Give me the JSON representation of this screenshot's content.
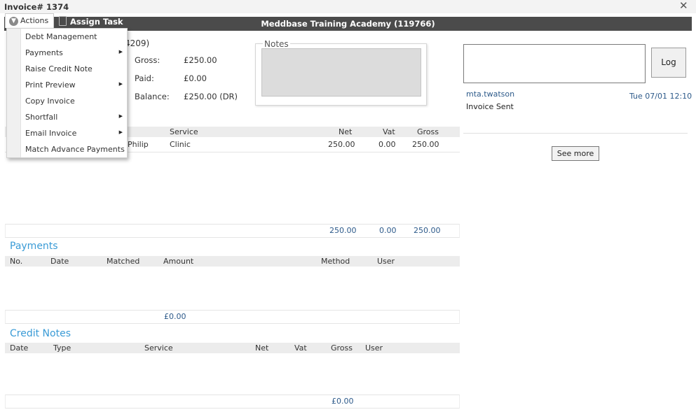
{
  "window": {
    "title": "Invoice# 1374",
    "close_glyph": "✕"
  },
  "header": {
    "title": "Meddbase Training Academy (119766)",
    "actions_label": "Actions",
    "assign_label": "Assign Task"
  },
  "actions_menu": {
    "items": [
      {
        "label": "Debt Management",
        "has_submenu": false
      },
      {
        "label": "Payments",
        "has_submenu": true
      },
      {
        "label": "Raise Credit Note",
        "has_submenu": false
      },
      {
        "label": "Print Preview",
        "has_submenu": true
      },
      {
        "label": "Copy Invoice",
        "has_submenu": false
      },
      {
        "label": "Shortfall",
        "has_submenu": true
      },
      {
        "label": "Email Invoice",
        "has_submenu": true
      },
      {
        "label": "Match Advance Payments",
        "has_submenu": false
      }
    ]
  },
  "invoice": {
    "partial_id": "4209)",
    "gross_label": "Gross:",
    "gross_value": "£250.00",
    "paid_label": "Paid:",
    "paid_value": "£0.00",
    "balance_label": "Balance:",
    "balance_value": "£250.00 (DR)"
  },
  "notes": {
    "legend": "Notes",
    "value": ""
  },
  "log": {
    "input_value": "",
    "button_label": "Log",
    "entries": [
      {
        "user": "mta.twatson",
        "date": "Tue 07/01 12:10",
        "message": "Invoice Sent"
      }
    ],
    "see_more_label": "See more"
  },
  "items_table": {
    "columns": {
      "service": "Service",
      "net": "Net",
      "vat": "Vat",
      "gross": "Gross"
    },
    "rows": [
      {
        "patient_partial": "Philip",
        "service": "Clinic",
        "net": "250.00",
        "vat": "0.00",
        "gross": "250.00"
      }
    ],
    "totals": {
      "net": "250.00",
      "vat": "0.00",
      "gross": "250.00"
    }
  },
  "payments": {
    "title": "Payments",
    "columns": {
      "no": "No.",
      "date": "Date",
      "matched": "Matched",
      "amount": "Amount",
      "method": "Method",
      "user": "User"
    },
    "total_amount": "£0.00"
  },
  "credit_notes": {
    "title": "Credit Notes",
    "columns": {
      "date": "Date",
      "type": "Type",
      "service": "Service",
      "net": "Net",
      "vat": "Vat",
      "gross": "Gross",
      "user": "User"
    },
    "total_gross": "£0.00"
  },
  "colors": {
    "header_bg": "#4b4b4b",
    "section_title": "#3a9bd6",
    "link_blue": "#2d5a8a",
    "table_head_bg": "#ececec"
  }
}
